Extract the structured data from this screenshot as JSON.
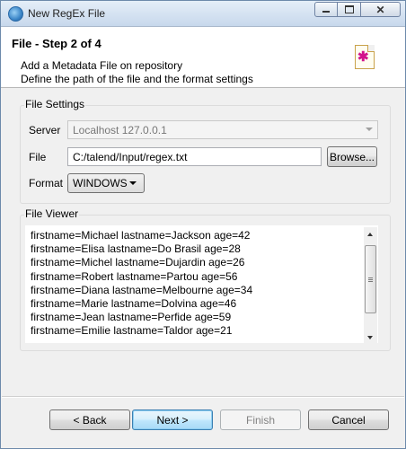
{
  "window": {
    "title": "New RegEx File"
  },
  "header": {
    "title": "File - Step 2 of 4",
    "description_line1": "Add a Metadata File on repository",
    "description_line2": "Define the path of the file and the format settings"
  },
  "file_settings": {
    "group_label": "File Settings",
    "server_label": "Server",
    "server_value": "Localhost 127.0.0.1",
    "file_label": "File",
    "file_value": "C:/talend/Input/regex.txt",
    "browse_label": "Browse...",
    "format_label": "Format",
    "format_value": "WINDOWS"
  },
  "file_viewer": {
    "group_label": "File Viewer",
    "lines": [
      "firstname=Michael lastname=Jackson age=42",
      "firstname=Elisa lastname=Do Brasil age=28",
      "firstname=Michel lastname=Dujardin age=26",
      "firstname=Robert lastname=Partou age=56",
      "firstname=Diana lastname=Melbourne age=34",
      "firstname=Marie lastname=Dolvina age=46",
      "firstname=Jean lastname=Perfide age=59",
      "firstname=Emilie lastname=Taldor age=21"
    ]
  },
  "buttons": {
    "back": "< Back",
    "next": "Next >",
    "finish": "Finish",
    "cancel": "Cancel"
  }
}
